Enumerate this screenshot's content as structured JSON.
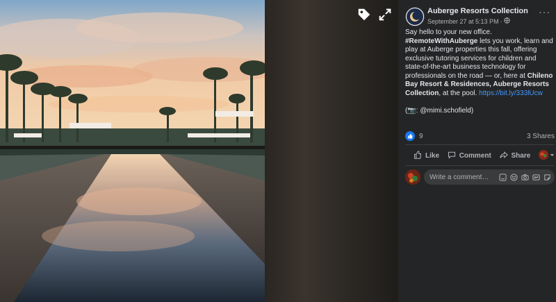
{
  "photo": {
    "description_icon": "image-icon"
  },
  "viewer": {
    "tag_icon": "tag-icon",
    "fullscreen_icon": "expand-icon"
  },
  "post": {
    "page_name": "Auberge Resorts Collection",
    "date": "September 27 at 5:13 PM",
    "separator": "·",
    "audience_icon": "globe-icon",
    "more_icon": "more-dots-icon",
    "text": {
      "line_intro": "Say hello to your new office.",
      "hashtag": "#RemoteWithAuberge",
      "body_1": " lets you work, learn and play at Auberge properties this fall, offering exclusive tutoring services for children and state-of-the-art business technology for professionals on the road — or, here at ",
      "place": "Chileno Bay Resort & Residences, Auberge Resorts Collection",
      "body_2": ", at the pool. ",
      "link": "https://bit.ly/333lUcw",
      "credit_prefix": "(📷: ",
      "credit_handle": "@mimi.schofield",
      "credit_suffix": ")"
    },
    "reaction_count": "9",
    "shares": "3 Shares",
    "actions": {
      "like": "Like",
      "comment": "Comment",
      "share": "Share"
    },
    "comment_placeholder": "Write a comment…"
  },
  "colors": {
    "panel_bg": "#242526",
    "text_primary": "#e4e6eb",
    "text_secondary": "#b0b3b8",
    "link": "#4599ff",
    "like_blue": "#1877f2"
  }
}
